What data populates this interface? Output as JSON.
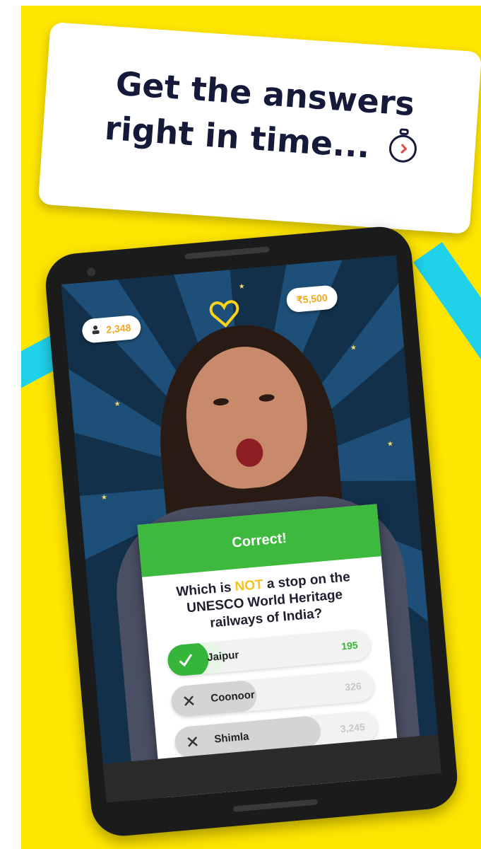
{
  "banner": {
    "headline": "Get the answers right in time..."
  },
  "stats": {
    "players": "2,348",
    "prize": "₹5,500"
  },
  "quiz": {
    "status": "Correct!",
    "question_pre": "Which is ",
    "question_highlight": "NOT",
    "question_post": " a stop on the UNESCO World Heritage railways of India?",
    "answers": [
      {
        "label": "Jaipur",
        "count": "195",
        "state": "correct",
        "fill": 0.28
      },
      {
        "label": "Coonoor",
        "count": "326",
        "state": "wrong",
        "fill": 0.42
      },
      {
        "label": "Shimla",
        "count": "3,245",
        "state": "wrong",
        "fill": 0.72
      }
    ]
  },
  "colors": {
    "background": "#ffe600",
    "ray": "#1fd2ea",
    "correct": "#3db93d",
    "highlight": "#f7c21a",
    "navy": "#161a3a"
  },
  "icons": [
    "stopwatch-icon",
    "users-icon",
    "heart-icon",
    "check-icon",
    "cross-icon"
  ]
}
